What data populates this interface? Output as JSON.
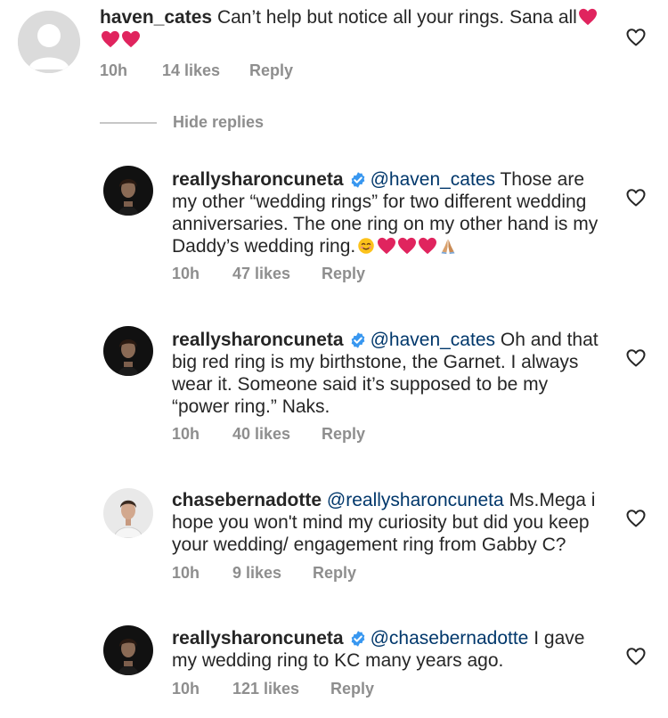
{
  "comments": [
    {
      "username": "haven_cates",
      "verified": false,
      "mention": "",
      "text": "Can’t help but notice all your rings. Sana all",
      "emojis": [
        "red-heart",
        "red-heart",
        "red-heart"
      ],
      "time": "10h",
      "likes": "14 likes",
      "reply": "Reply",
      "avatar": "default-avatar"
    },
    {
      "username": "reallysharoncuneta",
      "verified": true,
      "mention": "@haven_cates",
      "text": "Those are my other “wedding rings” for two different wedding anniversaries. The one ring on my other hand is my Daddy’s wedding ring.",
      "emojis": [
        "smiling-face",
        "red-heart",
        "red-heart",
        "red-heart",
        "folded-hands"
      ],
      "time": "10h",
      "likes": "47 likes",
      "reply": "Reply",
      "avatar": "sharon-avatar"
    },
    {
      "username": "reallysharoncuneta",
      "verified": true,
      "mention": "@haven_cates",
      "text": "Oh and that big red ring is my birthstone, the Garnet. I always wear it. Someone said it’s supposed to be my “power ring.” Naks.",
      "emojis": [],
      "time": "10h",
      "likes": "40 likes",
      "reply": "Reply",
      "avatar": "sharon-avatar"
    },
    {
      "username": "chasebernadotte",
      "verified": false,
      "mention": "@reallysharoncuneta",
      "text": "Ms.Mega i hope you won't mind my curiosity but did you keep your wedding/ engagement ring from Gabby C?",
      "emojis": [],
      "time": "10h",
      "likes": "9 likes",
      "reply": "Reply",
      "avatar": "chase-avatar"
    },
    {
      "username": "reallysharoncuneta",
      "verified": true,
      "mention": "@chasebernadotte",
      "text": "I gave my wedding ring to KC many years ago.",
      "emojis": [],
      "time": "10h",
      "likes": "121 likes",
      "reply": "Reply",
      "avatar": "sharon-avatar"
    }
  ],
  "hide_replies": "Hide replies",
  "colors": {
    "text": "#262626",
    "meta": "#8e8e8e",
    "mention": "#00376b",
    "verified": "#3897f0",
    "heart": "#e0245e"
  }
}
